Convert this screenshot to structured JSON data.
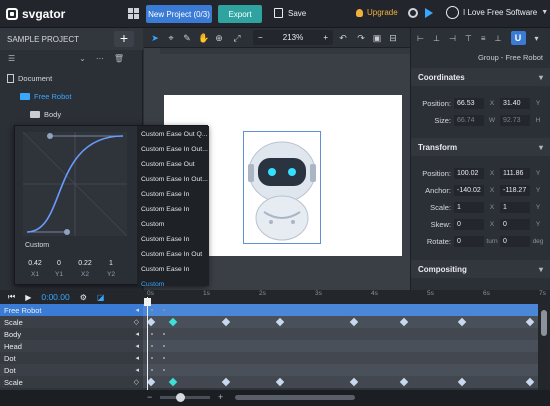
{
  "topbar": {
    "logo_text": "svgator",
    "new_project_label": "New Project (0/3)",
    "export_label": "Export",
    "save_label": "Save",
    "upgrade_label": "Upgrade",
    "user_name": "I Love Free Software"
  },
  "left_panel": {
    "title": "SAMPLE PROJECT",
    "add_label": "+",
    "tree": [
      {
        "label": "Document",
        "icon": "document-icon"
      },
      {
        "label": "Free Robot",
        "icon": "folder-icon"
      },
      {
        "label": "Body",
        "icon": "folder-icon"
      }
    ]
  },
  "canvas_toolbar": {
    "zoom_minus": "−",
    "zoom_value": "213%",
    "zoom_plus": "+"
  },
  "right_panel": {
    "group_title": "Group - Free Robot",
    "coordinates_title": "Coordinates",
    "position_label": "Position:",
    "position_x": "66.53",
    "position_y": "31.40",
    "size_label": "Size:",
    "size_w": "66.74",
    "size_h": "92.73",
    "transform_title": "Transform",
    "t_position_label": "Position:",
    "t_position_x": "100.02",
    "t_position_y": "111.86",
    "anchor_label": "Anchor:",
    "anchor_x": "-140.02",
    "anchor_y": "-118.27",
    "scale_label": "Scale:",
    "scale_x": "1",
    "scale_y": "1",
    "skew_label": "Skew:",
    "skew_x": "0",
    "skew_y": "0",
    "rotate_label": "Rotate:",
    "rotate_turn": "0",
    "rotate_turn_unit": "turn",
    "rotate_deg": "0",
    "rotate_deg_unit": "deg",
    "compositing_title": "Compositing",
    "unit_x": "X",
    "unit_y": "Y",
    "unit_w": "W",
    "unit_h": "H"
  },
  "easing_popover": {
    "curve_name": "Custom",
    "values": [
      "0.42",
      "0",
      "0.22",
      "1"
    ],
    "labels": [
      "X1",
      "Y1",
      "X2",
      "Y2"
    ],
    "presets": [
      "Custom Ease Out Q...",
      "Custom Ease In Out...",
      "Custom Ease Out",
      "Custom Ease In Out...",
      "Custom Ease In",
      "Custom Ease In",
      "Custom",
      "Custom Ease In",
      "Custom Ease In Out",
      "Custom Ease In",
      "Custom"
    ],
    "active_index": 10
  },
  "timeline": {
    "time": "0:00.00",
    "ticks": [
      "0s",
      "1s",
      "2s",
      "3s",
      "4s",
      "5s",
      "6s",
      "7s"
    ],
    "rows": [
      "Free Robot",
      "Scale",
      "Body",
      "Head",
      "Dot",
      "Dot",
      "Scale"
    ]
  },
  "colors": {
    "accent": "#3a7bd5",
    "export": "#2fa3a0",
    "upgrade": "#f0b23a",
    "keyframe_active": "#3ee0d6",
    "timeline_header_row": "#3a7bd5"
  }
}
